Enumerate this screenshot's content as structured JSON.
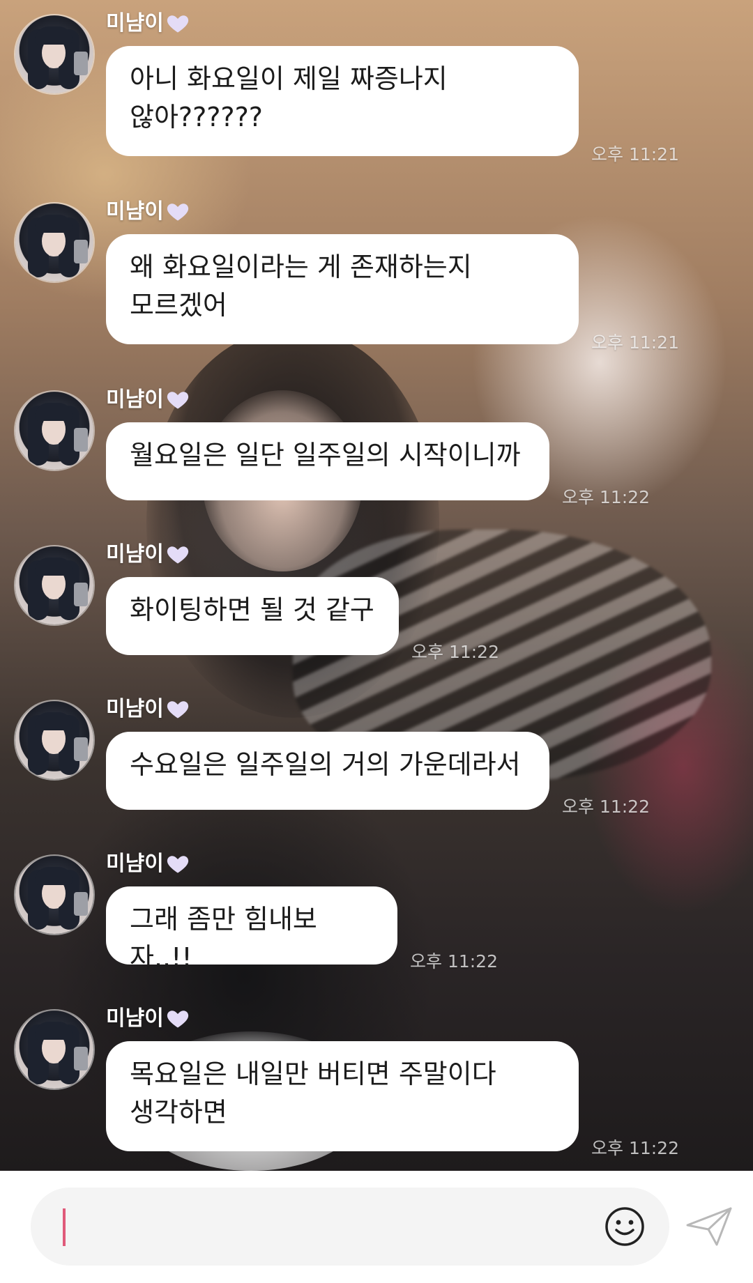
{
  "chat": {
    "messages": [
      {
        "sender": "미냠이",
        "text": "아니 화요일이 제일 짜증나지\n않아??????",
        "time": "오후 11:21"
      },
      {
        "sender": "미냠이",
        "text": "왜 화요일이라는 게 존재하는지\n모르겠어",
        "time": "오후 11:21"
      },
      {
        "sender": "미냠이",
        "text": "월요일은 일단 일주일의 시작이니까",
        "time": "오후 11:22"
      },
      {
        "sender": "미냠이",
        "text": "화이팅하면 될 것 같구",
        "time": "오후 11:22"
      },
      {
        "sender": "미냠이",
        "text": "수요일은 일주일의 거의 가운데라서",
        "time": "오후 11:22"
      },
      {
        "sender": "미냠이",
        "text": "그래 좀만 힘내보자..!!",
        "time": "오후 11:22"
      },
      {
        "sender": "미냠이",
        "text": "목요일은 내일만 버티면 주말이다\n생각하면",
        "time": "오후 11:22"
      }
    ],
    "sender_heart_color": "#e4dcf7"
  },
  "composer": {
    "input_value": "",
    "caret_color": "#e05a7a",
    "emoji_icon": "smiley-icon",
    "send_icon": "paper-plane-icon"
  }
}
